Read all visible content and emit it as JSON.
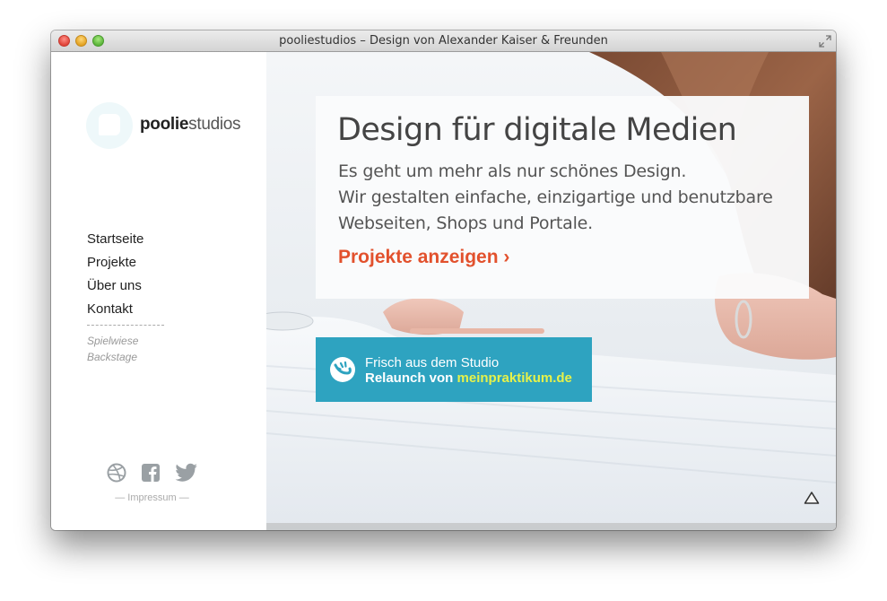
{
  "window": {
    "title": "pooliestudios – Design von Alexander Kaiser & Freunden"
  },
  "sidebar": {
    "logo": {
      "bold": "poolie",
      "light": "studios"
    },
    "nav": [
      "Startseite",
      "Projekte",
      "Über uns",
      "Kontakt"
    ],
    "subnav": [
      "Spielwiese",
      "Backstage"
    ],
    "social_icons": [
      "dribbble-icon",
      "facebook-icon",
      "twitter-icon"
    ],
    "impressum": "— Impressum —"
  },
  "hero": {
    "headline": "Design für digitale Medien",
    "lines": [
      "Es geht um mehr als nur schönes Design.",
      "Wir gestalten einfache, einzigartige und benutzbare",
      "Webseiten, Shops und Portale."
    ],
    "cta": "Projekte anzeigen ›",
    "cta_color": "#e2512d"
  },
  "studio_banner": {
    "line1": "Frisch aus dem Studio",
    "line2_prefix": "Relaunch von ",
    "line2_highlight": "meinpraktikum.de",
    "background": "#2ea3c0",
    "highlight_color": "#e6f24a"
  }
}
